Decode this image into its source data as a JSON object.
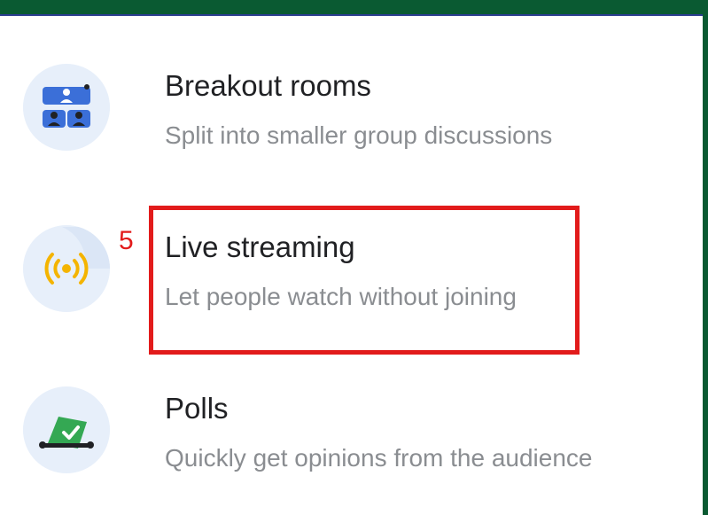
{
  "menu": {
    "items": [
      {
        "title": "Breakout rooms",
        "subtitle": "Split into smaller group discussions",
        "icon": "breakout-rooms-icon"
      },
      {
        "title": "Live streaming",
        "subtitle": "Let people watch without joining",
        "icon": "live-streaming-icon"
      },
      {
        "title": "Polls",
        "subtitle": "Quickly get opinions from the audience",
        "icon": "polls-icon"
      }
    ]
  },
  "annotation": {
    "step_label": "5",
    "color": "#e21b1b"
  },
  "colors": {
    "header_bar": "#0a5a32",
    "icon_background": "#e7effa",
    "breakout_icon": "#3b6fd8",
    "streaming_icon": "#f4b400",
    "polls_icon": "#34a853"
  }
}
